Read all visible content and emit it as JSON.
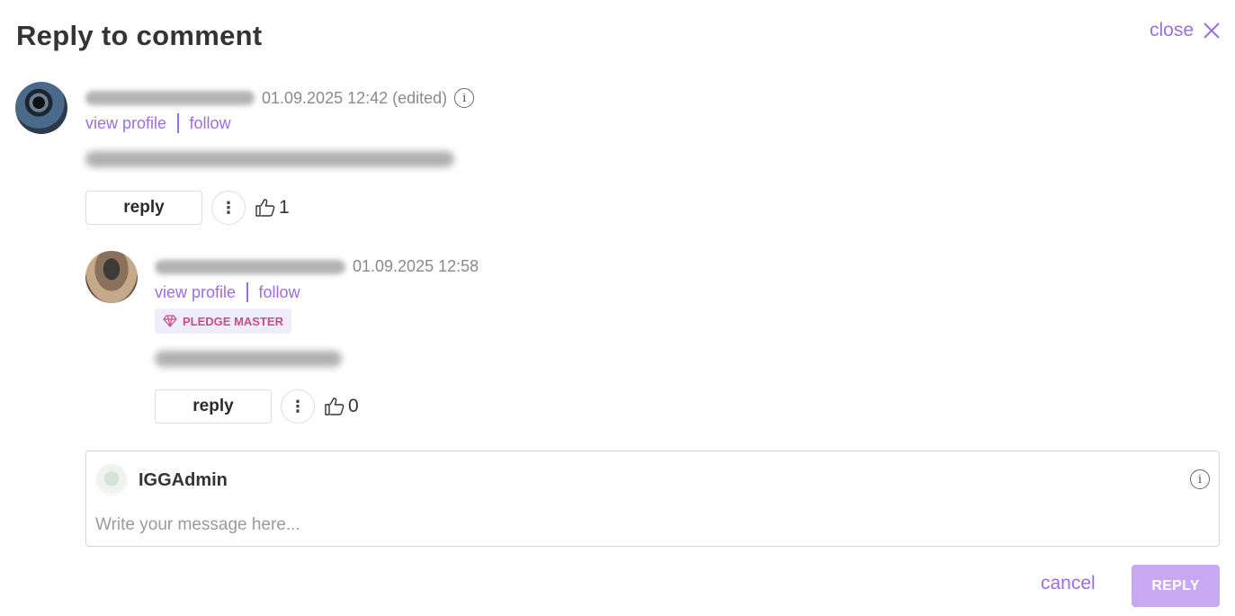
{
  "dialog": {
    "title": "Reply to comment",
    "close_label": "close"
  },
  "comments": [
    {
      "timestamp": "01.09.2025 12:42 (edited)",
      "view_profile": "view profile",
      "follow": "follow",
      "reply_label": "reply",
      "more_icon": "⋮",
      "likes": "1"
    },
    {
      "timestamp": "01.09.2025 12:58",
      "view_profile": "view profile",
      "follow": "follow",
      "badge": "PLEDGE MASTER",
      "reply_label": "reply",
      "more_icon": "⋮",
      "likes": "0"
    }
  ],
  "composer": {
    "username": "IGGAdmin",
    "placeholder": "Write your message here..."
  },
  "footer": {
    "cancel_label": "cancel",
    "submit_label": "REPLY"
  },
  "colors": {
    "accent": "#9d6ce6",
    "submit_disabled": "#c9a8f2",
    "badge_text": "#cc4b8a",
    "badge_bg": "#edeefa"
  },
  "icons": [
    "close-icon",
    "info-icon",
    "more-options-icon",
    "thumbs-up-icon",
    "diamond-icon"
  ]
}
